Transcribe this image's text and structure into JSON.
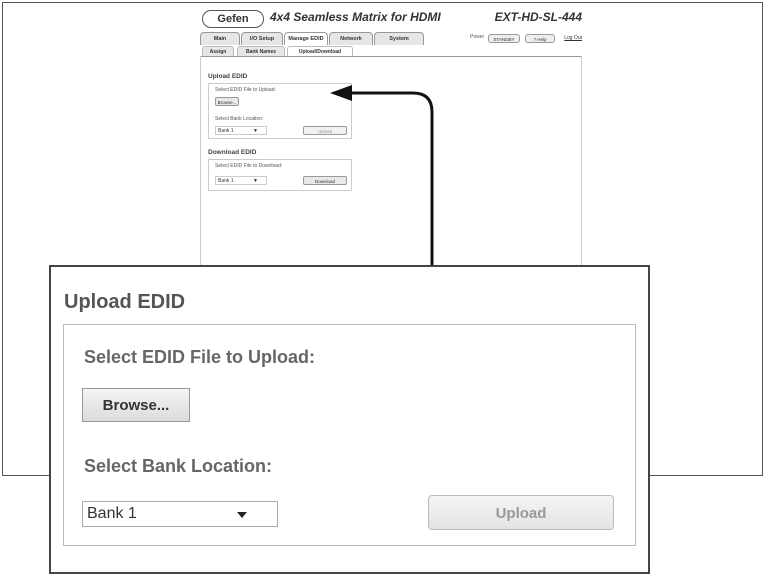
{
  "header": {
    "logo": "Gefen",
    "title": "4x4 Seamless Matrix for HDMI",
    "model": "EXT-HD-SL-444"
  },
  "tabs": [
    "Main",
    "I/O Setup",
    "Manage EDID",
    "Network",
    "System"
  ],
  "top_right": {
    "power_label": "Power",
    "standby": "STANDBY",
    "help": "? Help",
    "logout": "Log Out"
  },
  "subtabs": [
    "Assign",
    "Bank Names",
    "Upload/Download"
  ],
  "upload": {
    "title": "Upload EDID",
    "select_file_label": "Select EDID File to Upload:",
    "browse": "Browse...",
    "bank_label": "Select Bank Location:",
    "bank_value": "Bank 1",
    "upload_button": "Upload"
  },
  "download": {
    "title": "Download EDID",
    "select_file_label": "Select EDID File to Download:",
    "bank_value": "Bank 1",
    "download_button": "Download"
  },
  "zoom": {
    "title": "Upload EDID",
    "select_file_label": "Select EDID File to Upload:",
    "browse": "Browse...",
    "bank_label": "Select Bank Location:",
    "bank_value": "Bank 1",
    "upload_button": "Upload"
  }
}
